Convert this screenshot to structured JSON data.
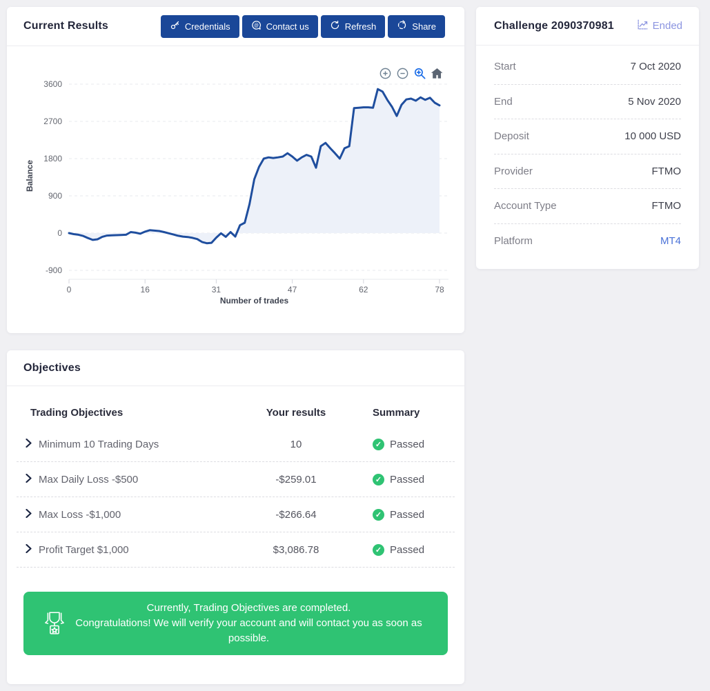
{
  "current_results": {
    "title": "Current Results",
    "buttons": [
      {
        "label": "Credentials",
        "icon": "key-icon"
      },
      {
        "label": "Contact us",
        "icon": "chat-icon"
      },
      {
        "label": "Refresh",
        "icon": "refresh-icon"
      },
      {
        "label": "Share",
        "icon": "share-icon"
      }
    ]
  },
  "chart_data": {
    "type": "area",
    "xlabel": "Number of trades",
    "ylabel": "Balance",
    "xlim": [
      0,
      78
    ],
    "ylim": [
      -900,
      3600
    ],
    "x_ticks": [
      0,
      16,
      31,
      47,
      62,
      78
    ],
    "y_ticks": [
      3600,
      2700,
      1800,
      900,
      0,
      -900
    ],
    "grid": "horizontal-dashed",
    "line_color": "#1f4e9e",
    "fill_color": "#edf1f9",
    "x_is_trade_index": true,
    "values": [
      0,
      -25,
      -40,
      -70,
      -120,
      -165,
      -150,
      -90,
      -60,
      -55,
      -50,
      -45,
      -40,
      25,
      10,
      -15,
      35,
      70,
      60,
      50,
      25,
      -5,
      -35,
      -65,
      -85,
      -95,
      -115,
      -145,
      -215,
      -245,
      -235,
      -110,
      -5,
      -90,
      25,
      -85,
      190,
      250,
      700,
      1300,
      1600,
      1800,
      1830,
      1815,
      1830,
      1850,
      1930,
      1850,
      1750,
      1830,
      1890,
      1850,
      1580,
      2100,
      2180,
      2050,
      1930,
      1800,
      2050,
      2100,
      3020,
      3030,
      3040,
      3040,
      3030,
      3480,
      3420,
      3220,
      3050,
      2830,
      3100,
      3230,
      3250,
      3200,
      3280,
      3220,
      3270,
      3150,
      3087
    ],
    "toolbar_icons": [
      "zoom-in",
      "zoom-out",
      "selection-zoom",
      "home"
    ]
  },
  "challenge": {
    "title": "Challenge 2090370981",
    "status": "Ended",
    "rows": [
      {
        "label": "Start",
        "value": "7 Oct 2020"
      },
      {
        "label": "End",
        "value": "5 Nov 2020"
      },
      {
        "label": "Deposit",
        "value": "10 000 USD"
      },
      {
        "label": "Provider",
        "value": "FTMO"
      },
      {
        "label": "Account Type",
        "value": "FTMO"
      },
      {
        "label": "Platform",
        "value": "MT4"
      }
    ]
  },
  "objectives": {
    "title": "Objectives",
    "table": {
      "headers": [
        "Trading Objectives",
        "Your results",
        "Summary"
      ],
      "rows": [
        {
          "objective": "Minimum 10 Trading Days",
          "result": "10",
          "summary": "Passed"
        },
        {
          "objective": "Max Daily Loss -$500",
          "result": "-$259.01",
          "summary": "Passed"
        },
        {
          "objective": "Max Loss -$1,000",
          "result": "-$266.64",
          "summary": "Passed"
        },
        {
          "objective": "Profit Target $1,000",
          "result": "$3,086.78",
          "summary": "Passed"
        }
      ]
    },
    "banner": {
      "line1": "Currently, Trading Objectives are completed.",
      "line2": "Congratulations! We will verify your account and will contact you as soon as possible.",
      "color": "#2fc373"
    }
  }
}
